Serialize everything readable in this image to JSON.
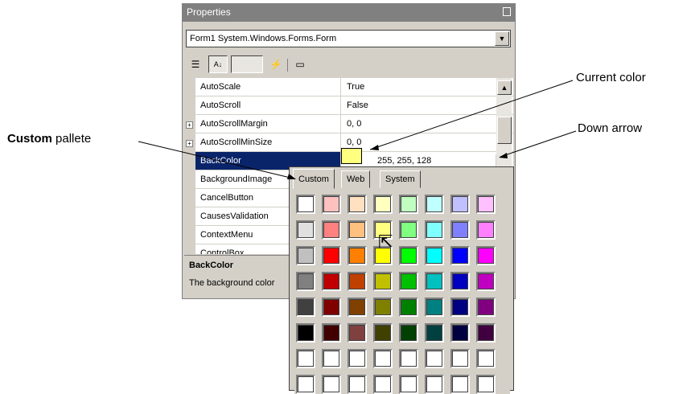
{
  "window": {
    "title": "Properties",
    "object_selector": "Form1 System.Windows.Forms.Form"
  },
  "toolbar": {
    "buttons": [
      {
        "icon": "categorized-icon"
      },
      {
        "icon": "alphabetic-icon"
      },
      {
        "icon": "properties-icon"
      },
      {
        "icon": "events-icon"
      },
      {
        "icon": "property-pages-icon"
      }
    ]
  },
  "grid": {
    "rows": [
      {
        "name": "AutoScale",
        "value": "True"
      },
      {
        "name": "AutoScroll",
        "value": "False"
      },
      {
        "name": "AutoScrollMargin",
        "value": "0, 0"
      },
      {
        "name": "AutoScrollMinSize",
        "value": "0, 0"
      },
      {
        "name": "BackColor",
        "value": "255, 255, 128"
      },
      {
        "name": "BackgroundImage",
        "value": ""
      },
      {
        "name": "CancelButton",
        "value": ""
      },
      {
        "name": "CausesValidation",
        "value": ""
      },
      {
        "name": "ContextMenu",
        "value": ""
      },
      {
        "name": "ControlBox",
        "value": ""
      }
    ],
    "selected_color": "#ffff80"
  },
  "description": {
    "heading": "BackColor",
    "text": "The background color"
  },
  "picker": {
    "tabs": [
      "Custom",
      "Web",
      "System"
    ],
    "active_tab": "Custom",
    "palette": [
      [
        "#ffffff",
        "#ffc0c0",
        "#ffe0c0",
        "#ffffc0",
        "#c0ffc0",
        "#c0ffff",
        "#c0c0ff",
        "#ffc0ff"
      ],
      [
        "#e0e0e0",
        "#ff8080",
        "#ffc080",
        "#ffff80",
        "#80ff80",
        "#80ffff",
        "#8080ff",
        "#ff80ff"
      ],
      [
        "#c0c0c0",
        "#ff0000",
        "#ff8000",
        "#ffff00",
        "#00ff00",
        "#00ffff",
        "#0000ff",
        "#ff00ff"
      ],
      [
        "#808080",
        "#c00000",
        "#c04000",
        "#c0c000",
        "#00c000",
        "#00c0c0",
        "#0000c0",
        "#c000c0"
      ],
      [
        "#404040",
        "#800000",
        "#804000",
        "#808000",
        "#008000",
        "#008080",
        "#000080",
        "#800080"
      ],
      [
        "#000000",
        "#400000",
        "#804040",
        "#404000",
        "#004000",
        "#004040",
        "#000040",
        "#400040"
      ],
      [
        "#ffffff",
        "#ffffff",
        "#ffffff",
        "#ffffff",
        "#ffffff",
        "#ffffff",
        "#ffffff",
        "#ffffff"
      ],
      [
        "#ffffff",
        "#ffffff",
        "#ffffff",
        "#ffffff",
        "#ffffff",
        "#ffffff",
        "#ffffff",
        "#ffffff"
      ]
    ]
  },
  "callouts": {
    "current_color": "Current color",
    "down_arrow": "Down arrow",
    "custom_bold": "Custom",
    "custom_rest": " pallete"
  }
}
